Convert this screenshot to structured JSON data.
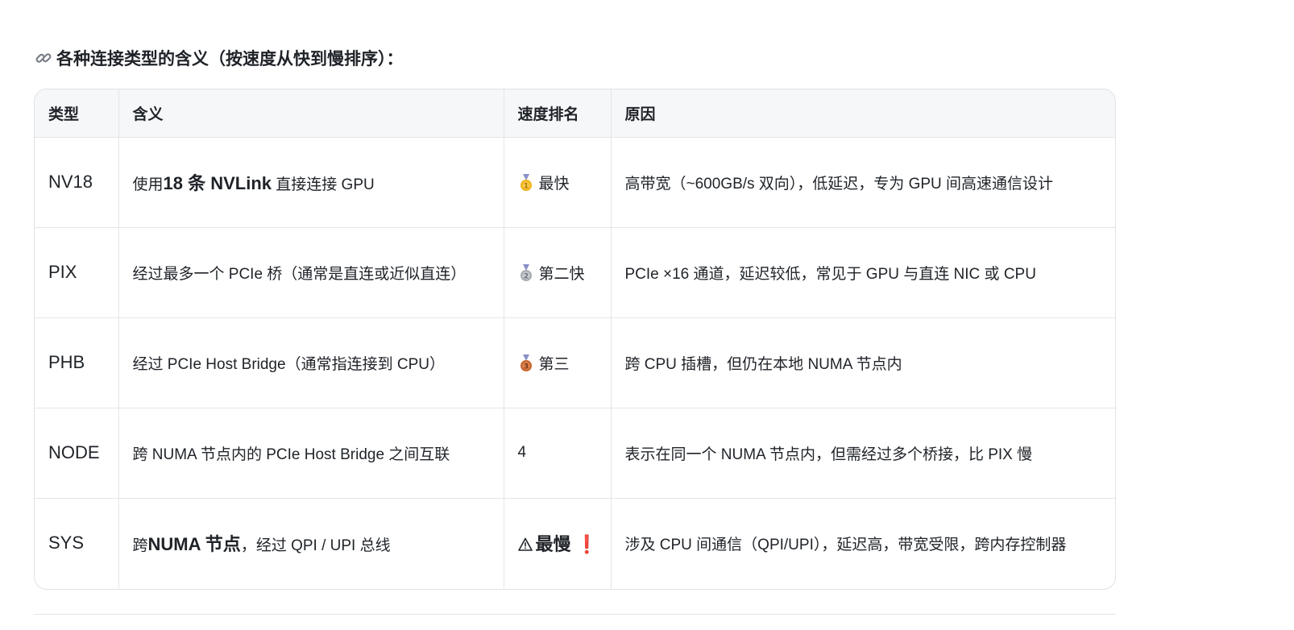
{
  "heading": {
    "icon": "link-icon",
    "text": "各种连接类型的含义（按速度从快到慢排序）："
  },
  "table": {
    "headers": [
      "类型",
      "含义",
      "速度排名",
      "原因"
    ],
    "rows": [
      {
        "type": "NV18",
        "meaning_prefix": "使用",
        "meaning_bold": "18 条 NVLink",
        "meaning_suffix": " 直接连接 GPU",
        "rank_icon": "gold-medal-icon",
        "rank": "最快",
        "reason": "高带宽（~600GB/s 双向），低延迟，专为 GPU 间高速通信设计"
      },
      {
        "type": "PIX",
        "meaning": "经过最多一个 PCIe 桥（通常是直连或近似直连）",
        "rank_icon": "silver-medal-icon",
        "rank": "第二快",
        "reason": "PCIe ×16 通道，延迟较低，常见于 GPU 与直连 NIC 或 CPU"
      },
      {
        "type": "PHB",
        "meaning": "经过 PCIe Host Bridge（通常指连接到 CPU）",
        "rank_icon": "bronze-medal-icon",
        "rank": "第三",
        "reason": "跨 CPU 插槽，但仍在本地 NUMA 节点内"
      },
      {
        "type": "NODE",
        "meaning": "跨 NUMA 节点内的 PCIe Host Bridge 之间互联",
        "rank": "4",
        "reason": "表示在同一个 NUMA 节点内，但需经过多个桥接，比 PIX 慢"
      },
      {
        "type": "SYS",
        "meaning_prefix": "跨",
        "meaning_bold": "NUMA 节点",
        "meaning_suffix": "，经过 QPI / UPI 总线",
        "rank_icon": "warning-icon",
        "rank": "最慢",
        "rank_suffix": "❗",
        "reason": "涉及 CPU 间通信（QPI/UPI），延迟高，带宽受限，跨内存控制器"
      }
    ]
  },
  "colors": {
    "gold": "#f2b21b",
    "silver": "#a9adb3",
    "bronze": "#c8662f",
    "ribbon": "#8b8fc7",
    "alert": "#e0262a"
  }
}
